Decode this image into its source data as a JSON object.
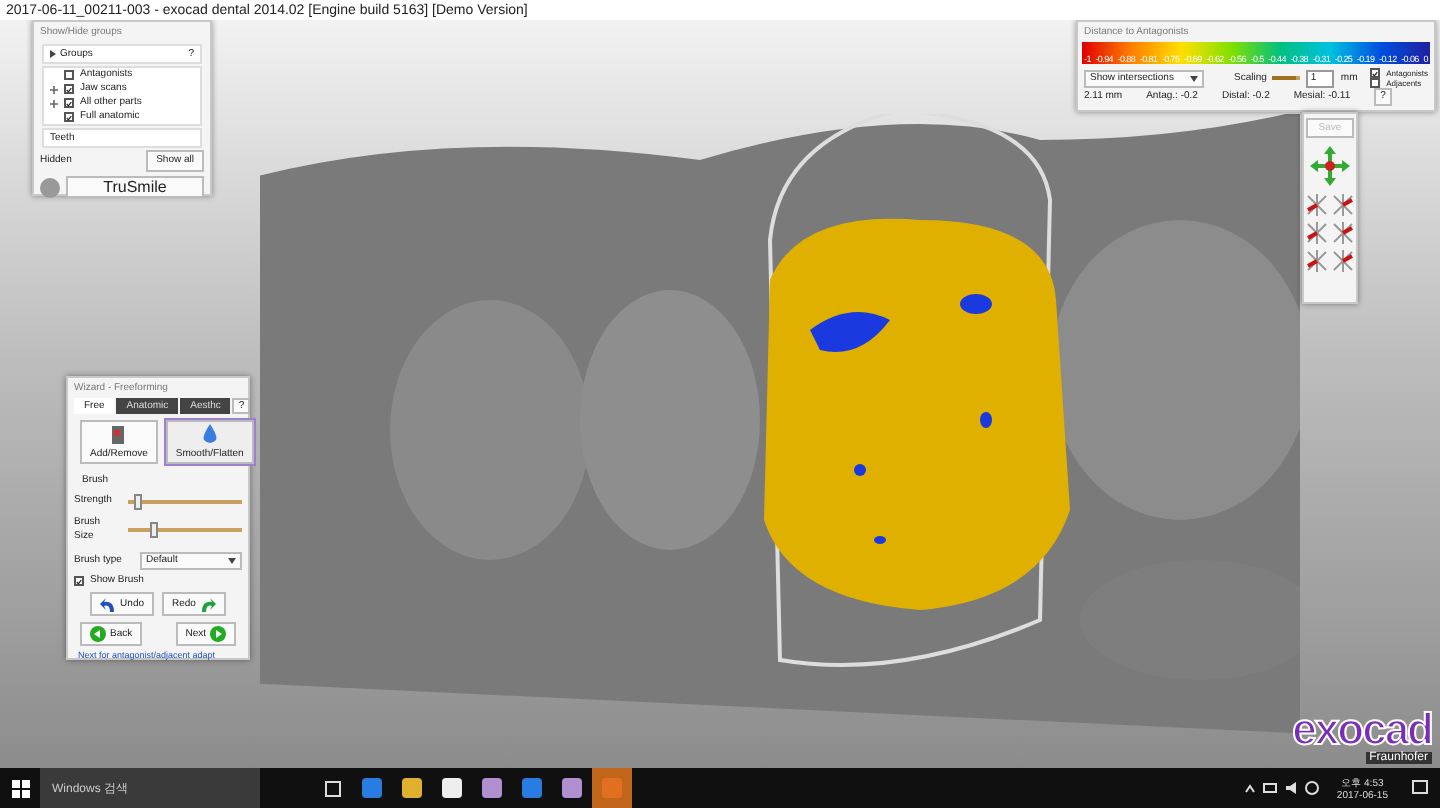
{
  "window": {
    "title": "2017-06-11_00211-003 - exocad dental 2014.02 [Engine build 5163] [Demo Version]"
  },
  "groups_panel": {
    "title": "Show/Hide groups",
    "groups_header": "Groups",
    "help": "?",
    "groups": [
      {
        "label": "Antagonists",
        "checked": false,
        "expandable": false
      },
      {
        "label": "Jaw scans",
        "checked": true,
        "expandable": true
      },
      {
        "label": "All other parts",
        "checked": true,
        "expandable": true
      },
      {
        "label": "Full anatomic",
        "checked": true,
        "expandable": false
      }
    ],
    "teeth_header": "Teeth",
    "hidden_header": "Hidden",
    "show_all": "Show all",
    "trusmile": "TruSmile"
  },
  "distance_panel": {
    "title": "Distance to Antagonists",
    "scale_labels": [
      "-1",
      "-0.94",
      "-0.88",
      "-0.81",
      "-0.75",
      "-0.69",
      "-0.62",
      "-0.56",
      "-0.5",
      "-0.44",
      "-0.38",
      "-0.31",
      "-0.25",
      "-0.19",
      "-0.12",
      "-0.06",
      "0"
    ],
    "mode": "Show intersections",
    "scaling": {
      "label": "Scaling",
      "level": 0.8,
      "value": "1"
    },
    "unit": "mm",
    "options": [
      {
        "label": "Antagonists",
        "checked": true
      },
      {
        "label": "Adjacents",
        "checked": false
      }
    ],
    "readings": [
      "2.11 mm",
      "Antag.: -0.2",
      "Distal: -0.2",
      "Mesial: -0.11"
    ],
    "help": "?"
  },
  "tool_panel": {
    "save": "Save",
    "save_disabled": true
  },
  "wizard": {
    "title": "Wizard - Freeforming",
    "tabs": [
      {
        "label": "Free",
        "selected": true
      },
      {
        "label": "Anatomic",
        "selected": false
      },
      {
        "label": "Aesthc",
        "selected": false
      }
    ],
    "help": "?",
    "tools": [
      {
        "label": "Add/Remove",
        "kind": "add",
        "selected": false
      },
      {
        "label": "Smooth/Flatten",
        "kind": "smooth",
        "selected": true
      }
    ],
    "brush_header": "Brush",
    "sliders": [
      {
        "label": "Strength",
        "level": 0.08
      },
      {
        "label": "Brush Size",
        "level": 0.22
      }
    ],
    "brush_type_label": "Brush type",
    "brush_type": "Default",
    "show_brush": {
      "label": "Show Brush",
      "checked": true
    },
    "undo": "Undo",
    "redo": "Redo",
    "back": "Back",
    "next": "Next",
    "hint": "Next for antagonist/adjacent adapt"
  },
  "logo": {
    "name": "exocad",
    "sub": "Fraunhofer"
  },
  "taskbar": {
    "search": "Windows 검색",
    "time": "오후 4:53",
    "date": "2017-06-15"
  }
}
